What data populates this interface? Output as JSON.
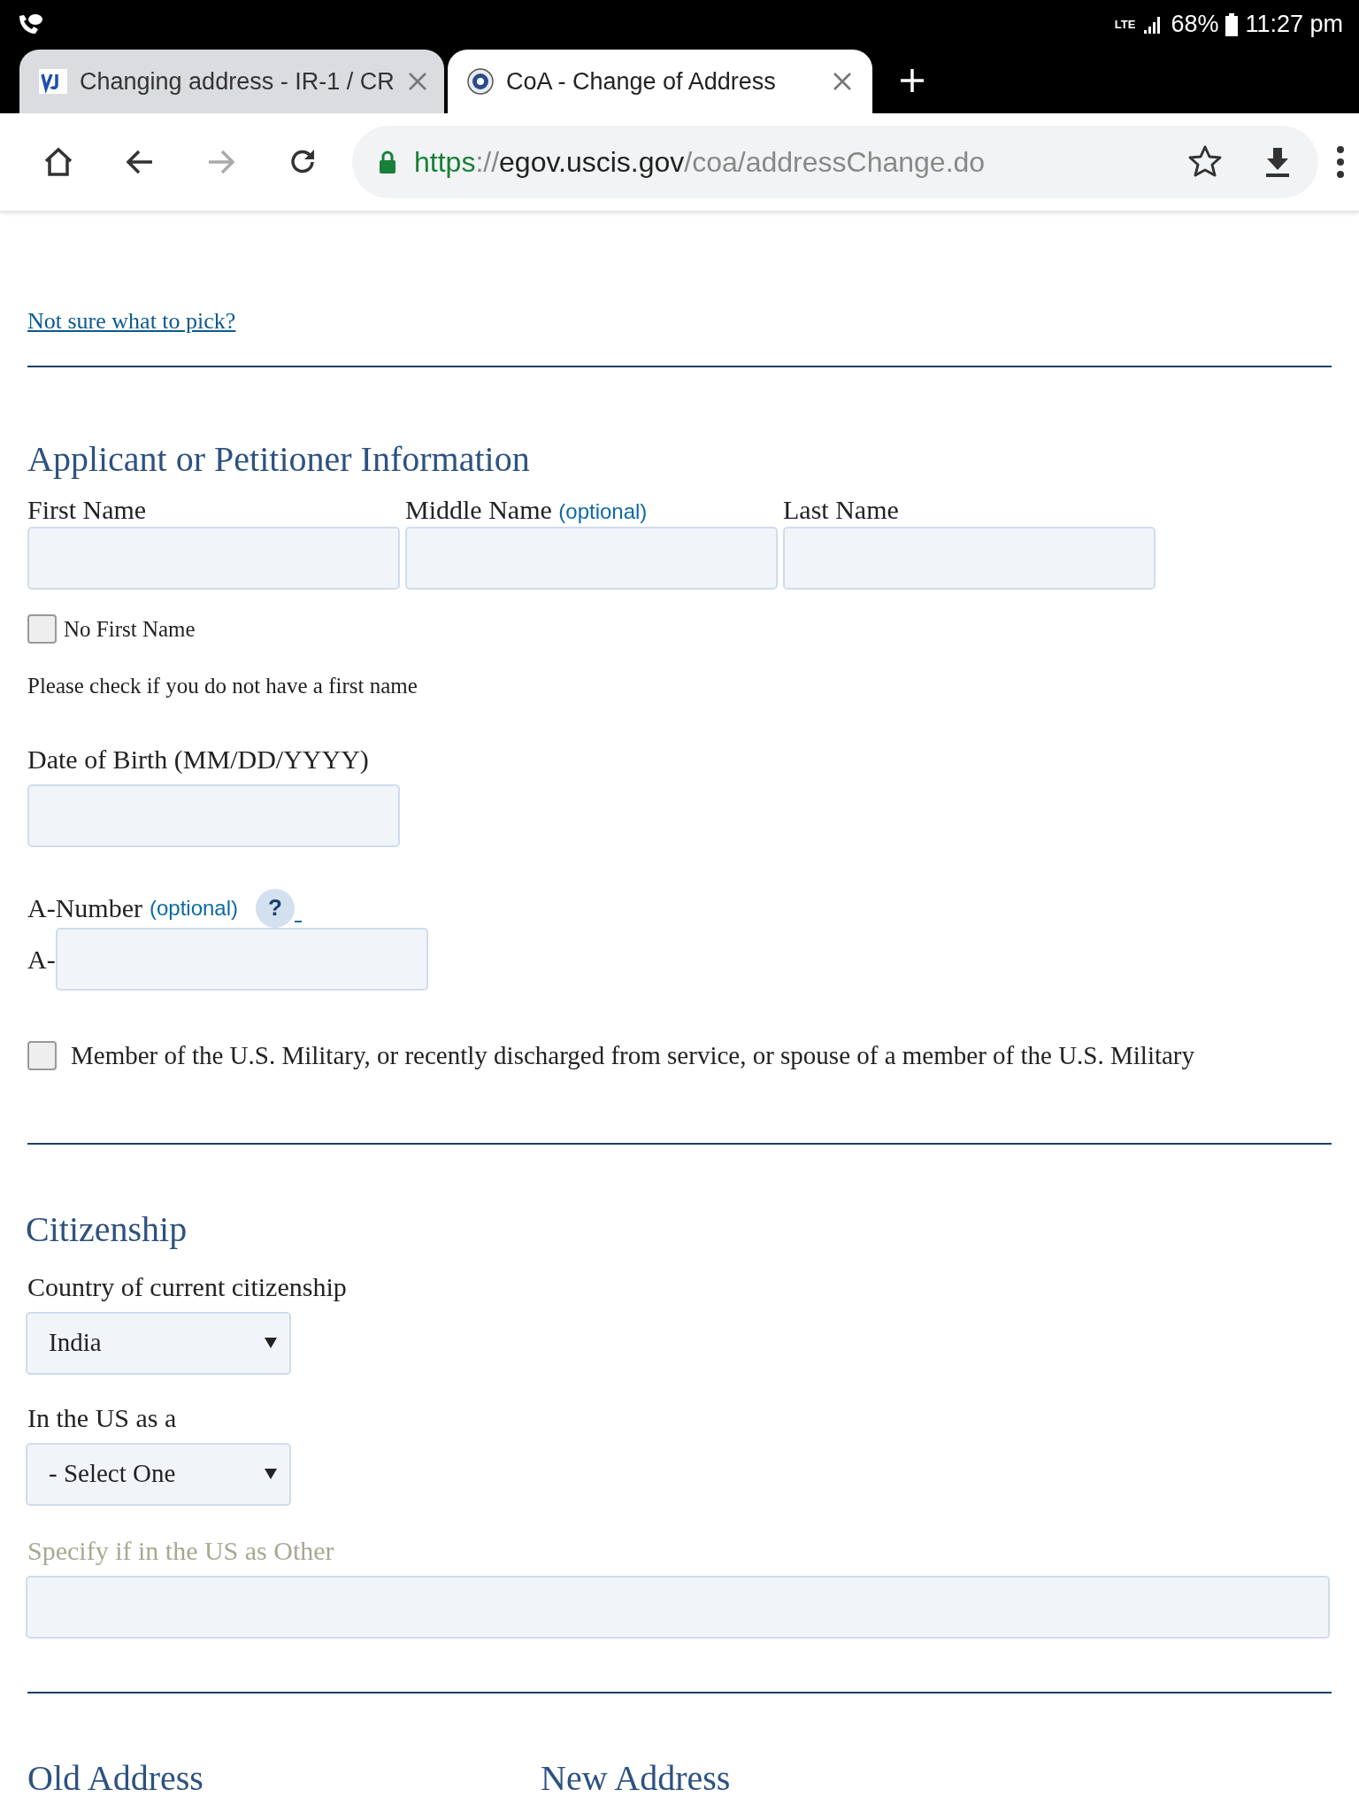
{
  "status_bar": {
    "network": "LTE",
    "battery": "68%",
    "time": "11:27 pm"
  },
  "browser": {
    "tabs": [
      {
        "title": "Changing address - IR-1 / CR",
        "selected": false
      },
      {
        "title": "CoA - Change of Address",
        "selected": true
      }
    ],
    "url": {
      "scheme": "https",
      "separator": "://",
      "host": "egov.uscis.gov",
      "path": "/coa/addressChange.do"
    }
  },
  "form": {
    "help_link": "Not sure what to pick?",
    "applicant": {
      "heading": "Applicant or Petitioner Information",
      "name_fields": [
        {
          "label": "First Name"
        },
        {
          "label": "Middle Name",
          "note": "(optional)"
        },
        {
          "label": "Last Name"
        }
      ],
      "no_first_name": {
        "label": "No First Name",
        "checked": false
      },
      "no_first_name_hint": "Please check if you do not have a first name",
      "date_of_birth": {
        "label": "Date of Birth (MM/DD/YYYY)"
      },
      "a_number": {
        "label": "A-Number",
        "note": "(optional)",
        "help": "?",
        "prefix": "A-"
      },
      "military": {
        "label": "Member of the U.S. Military, or recently discharged from service, or spouse of a member of the U.S. Military",
        "checked": false
      }
    },
    "citizenship": {
      "heading": "Citizenship",
      "country": {
        "label": "Country of current citizenship",
        "value": "India"
      },
      "status": {
        "label": "In the US as a",
        "value": "- Select One"
      },
      "other": {
        "label": "Specify if in the US as Other",
        "disabled": true
      }
    },
    "address_headings": [
      "Old Address",
      "New Address"
    ]
  }
}
